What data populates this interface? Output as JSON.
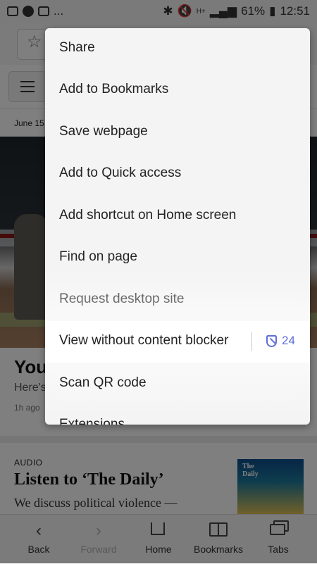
{
  "status_bar": {
    "battery": "61%",
    "time": "12:51",
    "network": "H+",
    "more": "..."
  },
  "page": {
    "date": "June 15",
    "headline": "You",
    "subheadline": "Here's",
    "time_ago": "1h ago",
    "audio": {
      "label": "AUDIO",
      "title": "Listen to ‘The Daily’",
      "description": "We discuss political violence —",
      "podcast_cover_text": "The Daily"
    }
  },
  "menu": {
    "items": [
      {
        "label": "Share"
      },
      {
        "label": "Add to Bookmarks"
      },
      {
        "label": "Save webpage"
      },
      {
        "label": "Add to Quick access"
      },
      {
        "label": "Add shortcut on Home screen"
      },
      {
        "label": "Find on page"
      },
      {
        "label": "Request desktop site"
      },
      {
        "label": "View without content blocker",
        "blocked_count": "24",
        "icon": "shield-icon"
      },
      {
        "label": "Scan QR code"
      },
      {
        "label": "Extensions"
      }
    ]
  },
  "bottom_nav": {
    "back": "Back",
    "forward": "Forward",
    "home": "Home",
    "bookmarks": "Bookmarks",
    "tabs": "Tabs"
  },
  "colors": {
    "accent": "#5e6fd8",
    "overlay": "rgba(0,0,0,0.5)"
  }
}
